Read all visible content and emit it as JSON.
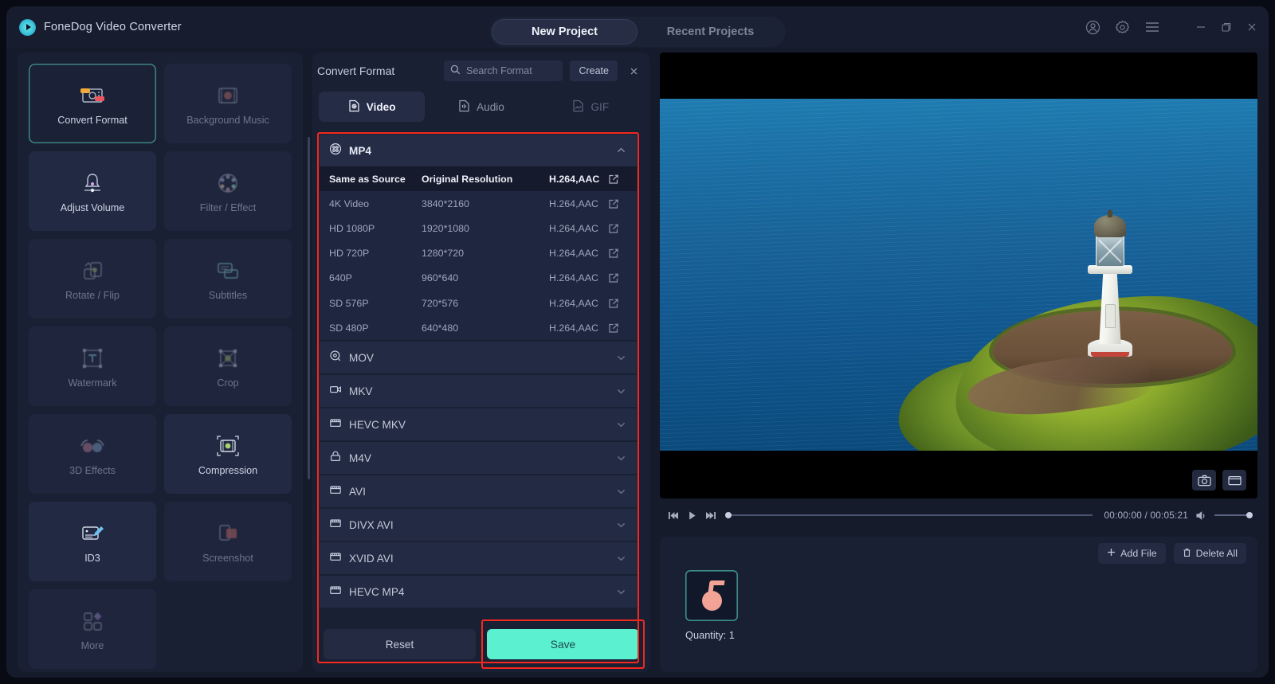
{
  "app": {
    "title": "FoneDog Video Converter",
    "logo_icon": "play-circle-icon"
  },
  "titlebar": {
    "tabs": [
      {
        "label": "New Project",
        "active": true
      },
      {
        "label": "Recent Projects",
        "active": false
      }
    ],
    "icons": [
      {
        "name": "account-icon"
      },
      {
        "name": "gear-icon"
      },
      {
        "name": "menu-icon"
      },
      {
        "name": "minimize-icon"
      },
      {
        "name": "restore-icon"
      },
      {
        "name": "close-icon"
      }
    ]
  },
  "sidebar": {
    "items": [
      {
        "label": "Convert Format",
        "icon": "convert-format-icon",
        "state": "selected"
      },
      {
        "label": "Background Music",
        "icon": "background-music-icon",
        "state": "dim"
      },
      {
        "label": "Adjust Volume",
        "icon": "adjust-volume-icon",
        "state": "normal"
      },
      {
        "label": "Filter / Effect",
        "icon": "filter-effect-icon",
        "state": "dim"
      },
      {
        "label": "Rotate / Flip",
        "icon": "rotate-flip-icon",
        "state": "dim"
      },
      {
        "label": "Subtitles",
        "icon": "subtitles-icon",
        "state": "dim"
      },
      {
        "label": "Watermark",
        "icon": "watermark-icon",
        "state": "dim"
      },
      {
        "label": "Crop",
        "icon": "crop-icon",
        "state": "dim"
      },
      {
        "label": "3D Effects",
        "icon": "three-d-effects-icon",
        "state": "dim"
      },
      {
        "label": "Compression",
        "icon": "compression-icon",
        "state": "normal"
      },
      {
        "label": "ID3",
        "icon": "id3-icon",
        "state": "normal"
      },
      {
        "label": "Screenshot",
        "icon": "screenshot-icon",
        "state": "dim"
      },
      {
        "label": "More",
        "icon": "more-icon",
        "state": "dim"
      }
    ]
  },
  "convert_panel": {
    "title": "Convert Format",
    "search_placeholder": "Search Format",
    "search_value": "",
    "create_label": "Create",
    "close_icon": "close-icon",
    "search_icon": "search-icon",
    "tabs": [
      {
        "label": "Video",
        "icon": "video-file-icon",
        "state": "active"
      },
      {
        "label": "Audio",
        "icon": "audio-file-icon",
        "state": "normal"
      },
      {
        "label": "GIF",
        "icon": "gif-file-icon",
        "state": "disabled"
      }
    ],
    "expanded_group": {
      "name": "MP4",
      "icon": "film-reel-icon",
      "caret": "chevron-up-icon",
      "rows": [
        {
          "preset": "Same as Source",
          "resolution": "Original Resolution",
          "codec": "H.264,AAC",
          "edit_icon": "edit-icon",
          "selected": true
        },
        {
          "preset": "4K Video",
          "resolution": "3840*2160",
          "codec": "H.264,AAC",
          "edit_icon": "edit-icon",
          "selected": false
        },
        {
          "preset": "HD 1080P",
          "resolution": "1920*1080",
          "codec": "H.264,AAC",
          "edit_icon": "edit-icon",
          "selected": false
        },
        {
          "preset": "HD 720P",
          "resolution": "1280*720",
          "codec": "H.264,AAC",
          "edit_icon": "edit-icon",
          "selected": false
        },
        {
          "preset": "640P",
          "resolution": "960*640",
          "codec": "H.264,AAC",
          "edit_icon": "edit-icon",
          "selected": false
        },
        {
          "preset": "SD 576P",
          "resolution": "720*576",
          "codec": "H.264,AAC",
          "edit_icon": "edit-icon",
          "selected": false
        },
        {
          "preset": "SD 480P",
          "resolution": "640*480",
          "codec": "H.264,AAC",
          "edit_icon": "edit-icon",
          "selected": false
        }
      ]
    },
    "collapsed_groups": [
      {
        "name": "MOV",
        "icon": "mov-icon",
        "caret": "chevron-down-icon"
      },
      {
        "name": "MKV",
        "icon": "mkv-icon",
        "caret": "chevron-down-icon"
      },
      {
        "name": "HEVC MKV",
        "icon": "hevc-icon",
        "caret": "chevron-down-icon"
      },
      {
        "name": "M4V",
        "icon": "m4v-icon",
        "caret": "chevron-down-icon"
      },
      {
        "name": "AVI",
        "icon": "avi-icon",
        "caret": "chevron-down-icon"
      },
      {
        "name": "DIVX AVI",
        "icon": "avi-icon",
        "caret": "chevron-down-icon"
      },
      {
        "name": "XVID AVI",
        "icon": "avi-icon",
        "caret": "chevron-down-icon"
      },
      {
        "name": "HEVC MP4",
        "icon": "hevc-icon",
        "caret": "chevron-down-icon"
      }
    ],
    "footer": {
      "reset_label": "Reset",
      "save_label": "Save"
    },
    "highlight_color": "#f4291d",
    "save_color": "#5bf0d0"
  },
  "player": {
    "controls": {
      "prev_icon": "skip-previous-icon",
      "play_icon": "play-icon",
      "next_icon": "skip-next-icon",
      "volume_icon": "volume-icon"
    },
    "time_display": "00:00:00 / 00:05:21",
    "current_time": "00:00:00",
    "duration": "00:05:21",
    "progress_percent": 0,
    "volume_percent": 100,
    "overlay_buttons": [
      {
        "name": "snapshot-icon"
      },
      {
        "name": "aspect-ratio-icon"
      }
    ]
  },
  "file_panel": {
    "add_file_label": "Add File",
    "add_file_icon": "plus-icon",
    "delete_all_label": "Delete All",
    "delete_all_icon": "trash-icon",
    "quantity_label": "Quantity: 1",
    "thumbnail_icon": "media-thumbnail"
  }
}
